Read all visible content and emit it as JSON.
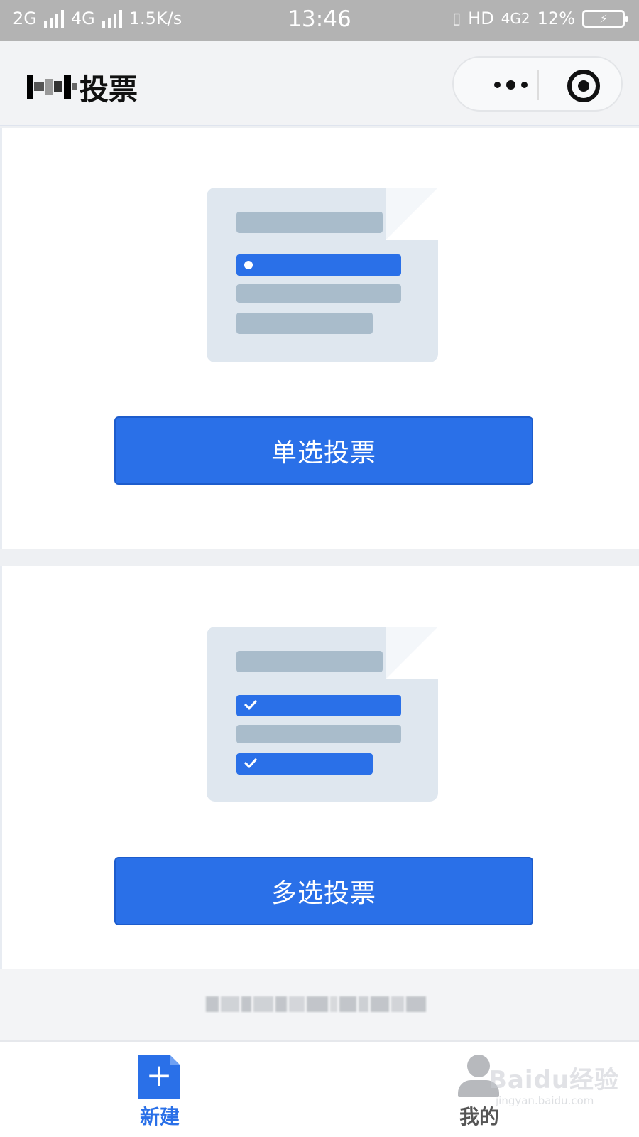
{
  "status_bar": {
    "signal1_label": "2G",
    "signal2_label": "4G",
    "network_speed": "1.5K/s",
    "time": "13:46",
    "hd_label": "HD",
    "network_type": "4G2",
    "battery_percent": "12%"
  },
  "navbar": {
    "title": "投票"
  },
  "cards": [
    {
      "button_label": "单选投票",
      "illustration": "single-choice-document"
    },
    {
      "button_label": "多选投票",
      "illustration": "multi-choice-document"
    }
  ],
  "tabbar": {
    "tabs": [
      {
        "label": "新建",
        "icon": "add-document-icon",
        "active": true
      },
      {
        "label": "我的",
        "icon": "user-icon",
        "active": false
      }
    ]
  },
  "watermark": {
    "brand": "Baidu经验",
    "url": "jingyan.baidu.com"
  },
  "colors": {
    "accent": "#2a70e8",
    "status_bar_bg": "#b3b3b3",
    "page_bg": "#eef0f3",
    "illustration_bg": "#dfe7ef",
    "illustration_line": "#a9bccb"
  }
}
